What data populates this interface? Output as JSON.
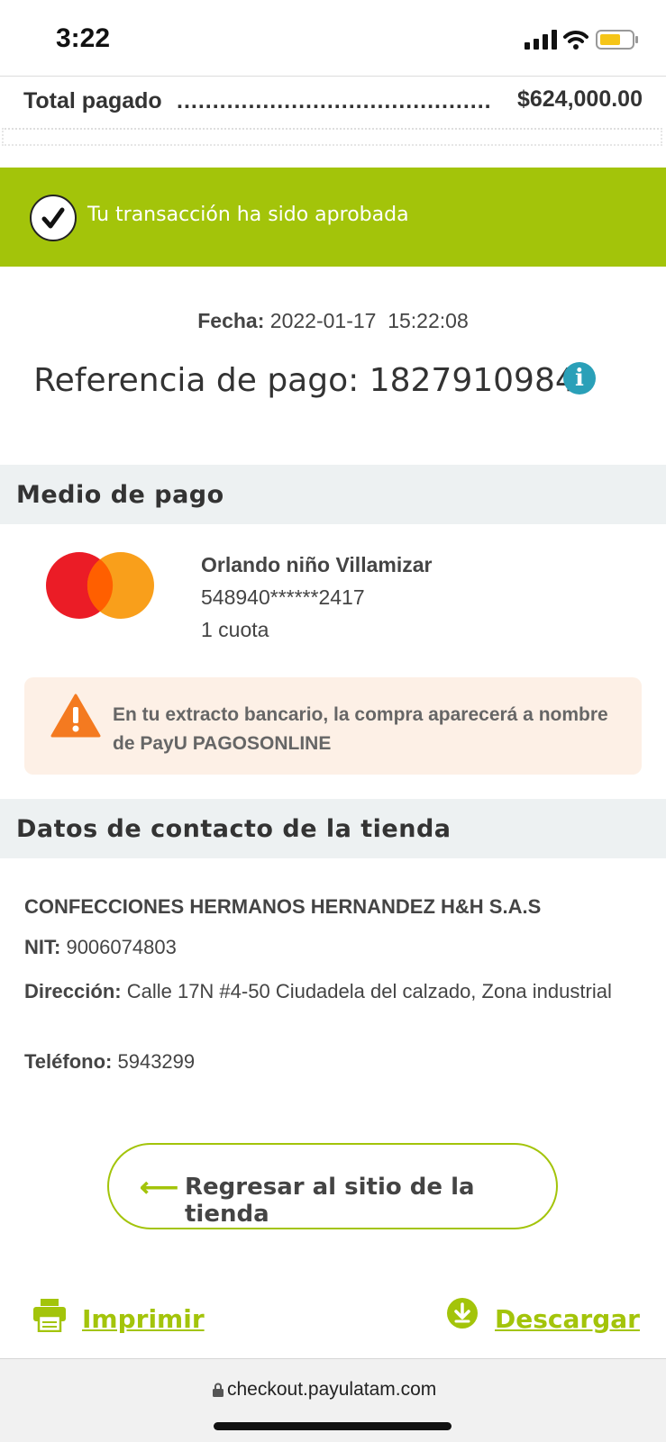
{
  "status_bar": {
    "time": "3:22"
  },
  "total": {
    "label": "Total pagado",
    "dots": "..................................................",
    "value": "$624,000.00"
  },
  "banner": {
    "message": "Tu transacción ha sido aprobada",
    "color": "#a3c40a"
  },
  "transaction": {
    "fecha_label": "Fecha:",
    "fecha_value": "2022-01-17  15:22:08",
    "referencia_label": "Referencia de pago:",
    "referencia_value": "1827910984",
    "info_glyph": "i"
  },
  "payment": {
    "section_title": "Medio de pago",
    "card_brand_icon": "mastercard-icon",
    "holder": "Orlando niño Villamizar",
    "card_number": "548940******2417",
    "installments": "1 cuota"
  },
  "warning": {
    "icon": "warning-icon",
    "text": "En tu extracto bancario, la compra aparecerá a nombre de PayU PAGOSONLINE"
  },
  "store": {
    "section_title": "Datos de contacto de la tienda",
    "name": "CONFECCIONES HERMANOS HERNANDEZ H&H S.A.S",
    "nit_label": "NIT:",
    "nit_value": "9006074803",
    "address_label": "Dirección:",
    "address_value": "Calle 17N #4-50 Ciudadela del calzado, Zona industrial",
    "phone_label": "Teléfono:",
    "phone_value": "5943299"
  },
  "actions": {
    "back_arrow": "⟵",
    "back_label": "Regresar al sitio de la tienda",
    "print_label": "Imprimir",
    "download_label": "Descargar"
  },
  "browser": {
    "url": "checkout.payulatam.com"
  }
}
